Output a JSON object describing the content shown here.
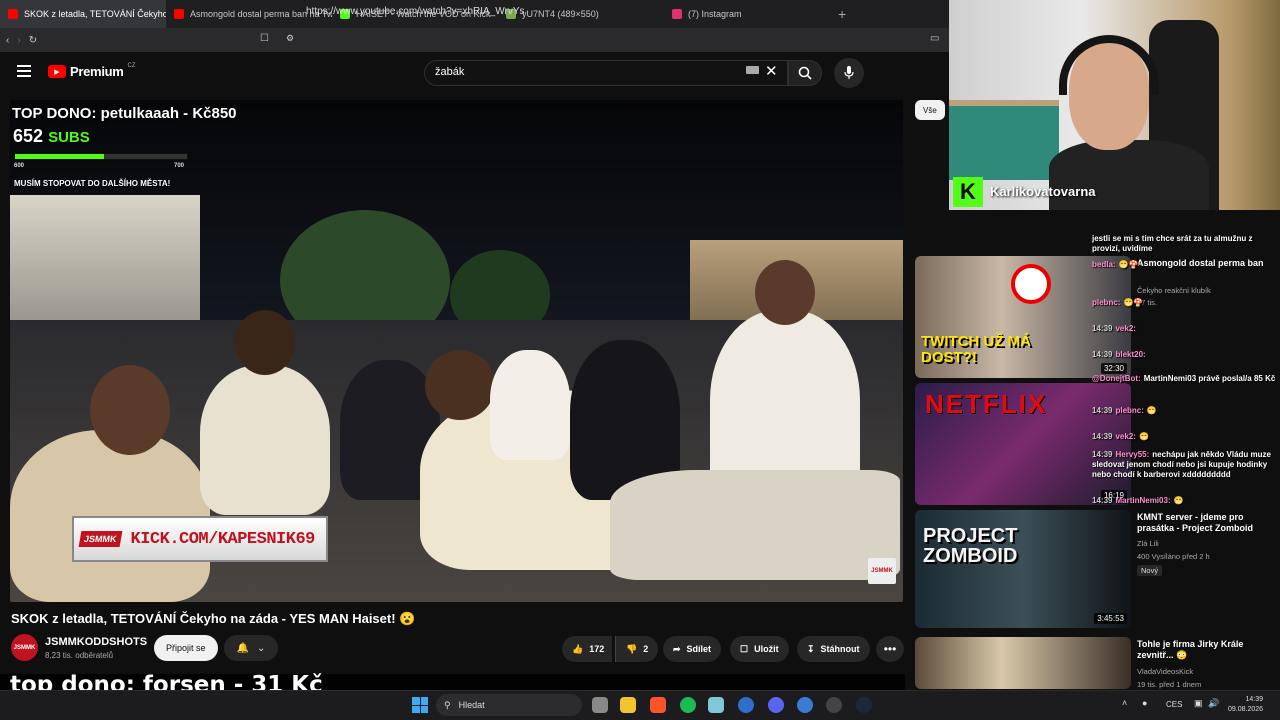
{
  "browser": {
    "tabs": [
      {
        "title": "SKOK z letadla, TETOVÁNÍ Čekyho",
        "color": "#ff0000",
        "active": true
      },
      {
        "title": "Asmongold dostal perma ban na Twi",
        "color": "#ff0000"
      },
      {
        "title": "HAISET - Watch the VOD on Kick",
        "color": "#53fc18"
      },
      {
        "title": "yU7NT4 (489×550)",
        "color": "#7da84c"
      },
      {
        "title": "(7) Instagram",
        "color": "#e1306c"
      }
    ],
    "tab_close": "×",
    "new_tab": "+",
    "url": "https://www.youtube.com/watch?v=xhRIA_WrvYs"
  },
  "youtube": {
    "logo": "Premium",
    "logo_region": "CZ",
    "search_value": "žabák"
  },
  "stream_overlay": {
    "top_dono": "TOP DONO: petulkaaah - Kč850",
    "subs_count": "652",
    "subs_label": "SUBS",
    "goal_min": "600",
    "goal_max": "700",
    "goal_progress": 0.52,
    "status_msg": "MUSÍM STOPOVAT DO DALŠÍHO MĚSTA!",
    "banner_logo": "JSMMK",
    "banner_text": "KICK.COM/KAPESNIK69",
    "watermark": "JSMMK",
    "bottom_text": "top dono:  forsen  - 31 Kč"
  },
  "video": {
    "title": "SKOK z letadla, TETOVÁNÍ Čekyho na záda - YES MAN Haiset! 😮",
    "channel": "JSMMKODDSHOTS",
    "channel_avatar": "JSMMK",
    "subscribers": "8,23 tis. odběratelů",
    "join_label": "Připojit se",
    "likes": "172",
    "dislikes": "2",
    "share_label": "Sdílet",
    "save_label": "Uložit",
    "download_label": "Stáhnout",
    "more_label": "•••"
  },
  "sidebar": {
    "filter_chip": "Vše",
    "recommendations": [
      {
        "thumb_text": "TWITCH UŽ MÁ DOST?!",
        "duration": "32:30",
        "title": "Asmongold dostal perma ban",
        "channel": "Čekyho reakční klubík",
        "meta": "27 tis."
      },
      {
        "thumb_text": "NETFLIX",
        "duration": "16:19",
        "title": "",
        "channel": "",
        "meta": ""
      },
      {
        "thumb_text": "PROJECT ZOMBOID",
        "duration": "3:45:53",
        "title": "KMNT server - jdeme pro prasátka - Project Zomboid",
        "channel": "Zlá Lili",
        "meta": "400  Vysíláno před 2 h",
        "badge": "Nový"
      },
      {
        "thumb_text": "",
        "duration": "",
        "title": "Tohle je firma Jirky Krále zevnitř... 😳",
        "channel": "VladaVideosKick",
        "meta": "19 tis.  před 1 dnem"
      }
    ]
  },
  "webcam": {
    "kick_badge": "K",
    "streamer_name": "Karlikovatovarna"
  },
  "chat": [
    {
      "time": "",
      "user": "",
      "text": "jestli se mi s tim chce srát za tu almužnu z provizí, uvidíme"
    },
    {
      "time": "",
      "user": "bedla:",
      "text": "😁🍄"
    },
    {
      "time": "",
      "user": "plebnc:",
      "text": "😁🍄"
    },
    {
      "time": "14:39",
      "user": "vek2:",
      "text": ""
    },
    {
      "time": "14:39",
      "user": "blekt20:",
      "text": ""
    },
    {
      "time": "",
      "user": "@DonejtBot:",
      "text": "MartinNemi03 právě poslal/a 85 Kč"
    },
    {
      "time": "14:39",
      "user": "plebnc:",
      "text": "😁"
    },
    {
      "time": "14:39",
      "user": "vek2:",
      "text": "😁"
    },
    {
      "time": "14:39",
      "user": "Hervy55:",
      "text": "nechápu jak někdo Vládu muze sledovat jenom chodí nebo jsi kupuje hodinky nebo chodí k barberovi xddddddddd"
    },
    {
      "time": "14:39",
      "user": "MartinNemi03:",
      "text": "😁"
    }
  ],
  "taskbar": {
    "search_label": "Hledat",
    "lang": "CES",
    "time": "14:39",
    "date": "09.08.2026"
  }
}
